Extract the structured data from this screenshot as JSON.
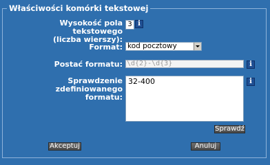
{
  "panel": {
    "title": "Właściwości komórki tekstowej"
  },
  "fields": {
    "height_label_line1": "Wysokość pola tekstowego",
    "height_label_line2": "(liczba wierszy):",
    "height_value": "3",
    "format_label": "Format:",
    "format_selected": "kod pocztowy",
    "format_pattern_label": "Postać formatu:",
    "format_pattern_value": "\\d{2}-\\d{3}",
    "check_label_line1": "Sprawdzenie zdefiniowanego",
    "check_label_line2": "formatu:",
    "check_value": "32-400"
  },
  "buttons": {
    "check": "Sprawdź",
    "accept": "Akceptuj",
    "cancel": "Anuluj"
  },
  "icons": {
    "info": "i"
  }
}
